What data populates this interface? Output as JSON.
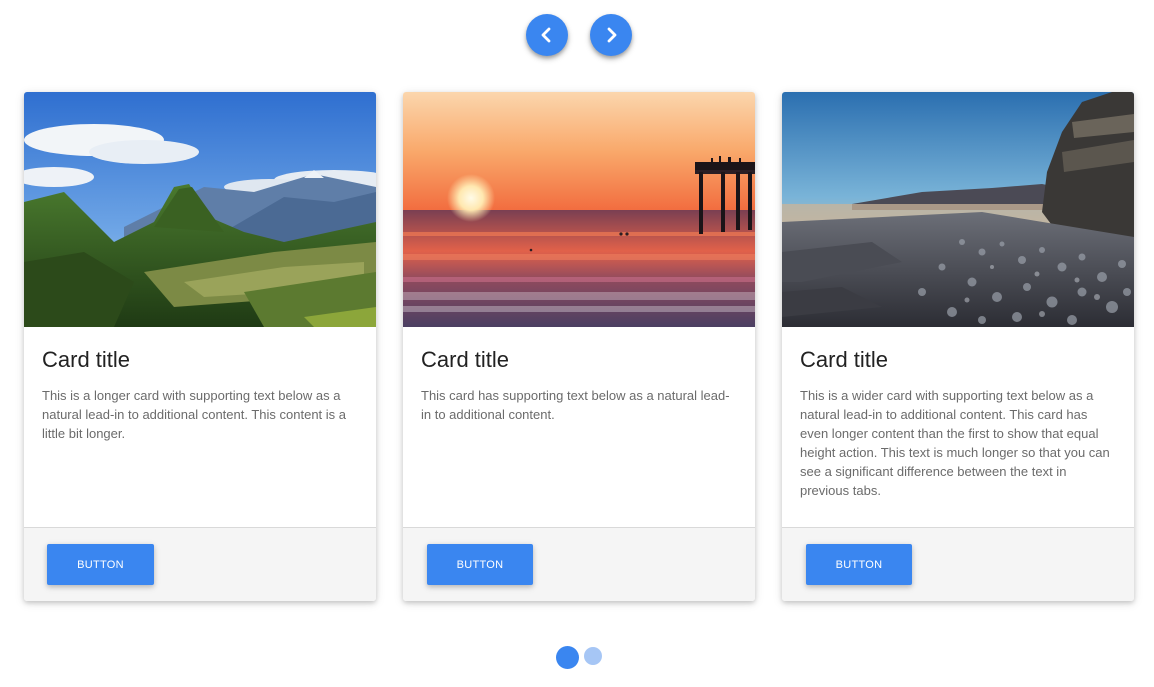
{
  "carousel": {
    "prev_icon": "chevron-left-icon",
    "next_icon": "chevron-right-icon",
    "accent_color": "#3a86f0",
    "inactive_dot_color": "#a6c6f5",
    "active_slide": 1,
    "total_slides": 2
  },
  "cards": [
    {
      "image": "mountain-ruins-landscape",
      "title": "Card title",
      "text": "This is a longer card with supporting text below as a natural lead-in to additional content. This content is a little bit longer.",
      "button_label": "BUTTON"
    },
    {
      "image": "sunset-pier-beach",
      "title": "Card title",
      "text": "This card has supporting text below as a natural lead-in to additional content.",
      "button_label": "BUTTON"
    },
    {
      "image": "rocky-pebble-shore-cliff",
      "title": "Card title",
      "text": "This is a wider card with supporting text below as a natural lead-in to additional content. This card has even longer content than the first to show that equal height action. This text is much longer so that you can see a significant difference between the text in previous tabs.",
      "button_label": "BUTTON"
    }
  ]
}
